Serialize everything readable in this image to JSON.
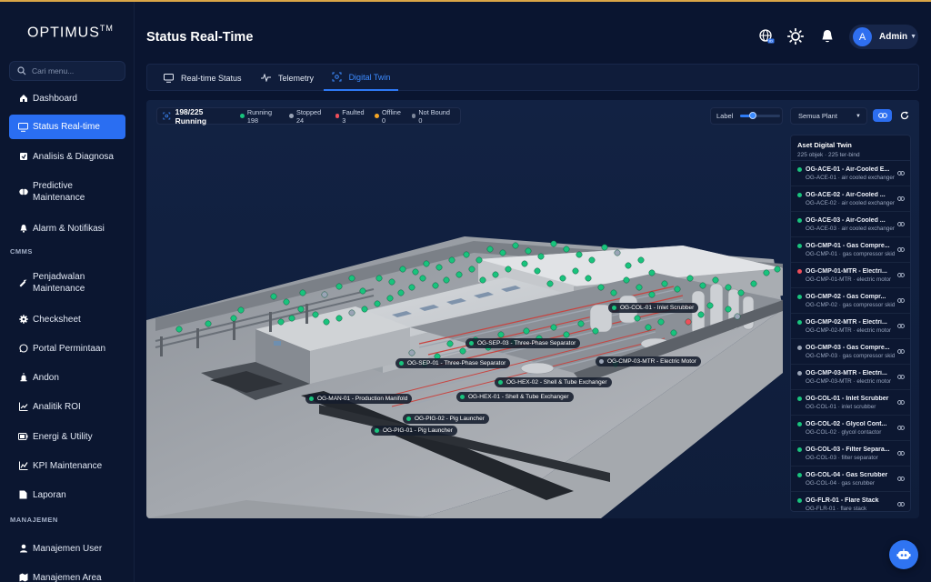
{
  "app": {
    "logo": "OPTIMUS",
    "logo_tm": "TM"
  },
  "sidebar": {
    "search_placeholder": "Cari menu...",
    "items": [
      {
        "label": "Dashboard",
        "icon": "home-icon"
      },
      {
        "label": "Status Real-time",
        "icon": "monitor-icon",
        "active": true
      },
      {
        "label": "Analisis & Diagnosa",
        "icon": "clipboard-icon"
      },
      {
        "label": "Predictive Maintenance",
        "icon": "brain-icon"
      },
      {
        "label": "Alarm & Notifikasi",
        "icon": "bell-icon"
      }
    ],
    "section_cmms": "CMMS",
    "cmms_items": [
      {
        "label": "Penjadwalan Maintenance",
        "icon": "wrench-icon"
      },
      {
        "label": "Checksheet",
        "icon": "gear-icon"
      },
      {
        "label": "Portal Permintaan",
        "icon": "whatsapp-icon"
      },
      {
        "label": "Andon",
        "icon": "siren-icon"
      },
      {
        "label": "Analitik ROI",
        "icon": "trend-icon"
      },
      {
        "label": "Energi & Utility",
        "icon": "battery-icon"
      },
      {
        "label": "KPI Maintenance",
        "icon": "chart-line-icon"
      },
      {
        "label": "Laporan",
        "icon": "document-icon"
      }
    ],
    "section_manajemen": "MANAJEMEN",
    "manajemen_items": [
      {
        "label": "Manajemen User",
        "icon": "user-icon"
      },
      {
        "label": "Manajemen Area",
        "icon": "map-icon"
      }
    ]
  },
  "header": {
    "title": "Status Real-Time",
    "lang_badge": "ID",
    "user_initial": "A",
    "user_name": "Admin"
  },
  "tabs": [
    {
      "label": "Real-time Status",
      "icon": "monitor-icon"
    },
    {
      "label": "Telemetry",
      "icon": "pulse-icon"
    },
    {
      "label": "Digital Twin",
      "icon": "twin-icon",
      "active": true
    }
  ],
  "status_bar": {
    "running_total": "198/225 Running",
    "items": [
      {
        "label": "Running 198",
        "color": "#19c37d"
      },
      {
        "label": "Stopped 24",
        "color": "#9aa4b6"
      },
      {
        "label": "Faulted 3",
        "color": "#ef4e5a"
      },
      {
        "label": "Offline 0",
        "color": "#f5a524"
      },
      {
        "label": "Not Bound 0",
        "color": "#7e889b"
      }
    ]
  },
  "controls": {
    "label_text": "Label",
    "label_slider_level": 0.3,
    "plant_select": "Semua Plant"
  },
  "asset_panel": {
    "title": "Aset Digital Twin",
    "subtitle": "225 objek · 225 ter-bind",
    "items": [
      {
        "name": "OG-ACE-01 - Air-Cooled E...",
        "desc": "OG-ACE-01 · air cooled exchanger",
        "status": "running"
      },
      {
        "name": "OG-ACE-02 - Air-Cooled ...",
        "desc": "OG-ACE-02 · air cooled exchanger",
        "status": "running"
      },
      {
        "name": "OG-ACE-03 - Air-Cooled ...",
        "desc": "OG-ACE-03 · air cooled exchanger",
        "status": "running"
      },
      {
        "name": "OG-CMP-01 - Gas Compre...",
        "desc": "OG-CMP-01 · gas compressor skid",
        "status": "running"
      },
      {
        "name": "OG-CMP-01-MTR - Electri...",
        "desc": "OG-CMP-01-MTR · electric motor",
        "status": "faulted"
      },
      {
        "name": "OG-CMP-02 - Gas Compr...",
        "desc": "OG-CMP-02 · gas compressor skid",
        "status": "running"
      },
      {
        "name": "OG-CMP-02-MTR - Electri...",
        "desc": "OG-CMP-02-MTR · electric motor",
        "status": "running"
      },
      {
        "name": "OG-CMP-03 - Gas Compre...",
        "desc": "OG-CMP-03 · gas compressor skid",
        "status": "stopped"
      },
      {
        "name": "OG-CMP-03-MTR - Electri...",
        "desc": "OG-CMP-03-MTR · electric motor",
        "status": "stopped"
      },
      {
        "name": "OG-COL-01 - Inlet Scrubber",
        "desc": "OG-COL-01 · inlet scrubber",
        "status": "running"
      },
      {
        "name": "OG-COL-02 - Glycol Cont...",
        "desc": "OG-COL-02 · glycol contactor",
        "status": "running"
      },
      {
        "name": "OG-COL-03 - Filter Separa...",
        "desc": "OG-COL-03 · filter separator",
        "status": "running"
      },
      {
        "name": "OG-COL-04 - Gas Scrubber",
        "desc": "OG-COL-04 · gas scrubber",
        "status": "running"
      },
      {
        "name": "OG-FLR-01 - Flare Stack",
        "desc": "OG-FLR-01 · flare stack",
        "status": "running"
      }
    ]
  },
  "scene_labels": [
    {
      "text": "OG-COL-01 - Inlet Scrubber",
      "status": "running"
    },
    {
      "text": "OG-SEP-03 - Three-Phase Separator",
      "status": "running"
    },
    {
      "text": "OG-SEP-01 - Three-Phase Separator",
      "status": "running"
    },
    {
      "text": "OG-CMP-03-MTR - Electric Motor",
      "status": "stopped"
    },
    {
      "text": "OG-HEX-02 - Shell & Tube Exchanger",
      "status": "running"
    },
    {
      "text": "OG-MAN-01 - Production Manifold",
      "status": "running"
    },
    {
      "text": "OG-HEX-01 - Shell & Tube Exchanger",
      "status": "running"
    },
    {
      "text": "OG-PIG-02 - Pig Launcher",
      "status": "running"
    },
    {
      "text": "OG-PIG-01 - Pig Launcher",
      "status": "running"
    }
  ],
  "status_colors": {
    "running": "#19c37d",
    "stopped": "#9aa4b6",
    "faulted": "#ef4e5a"
  }
}
